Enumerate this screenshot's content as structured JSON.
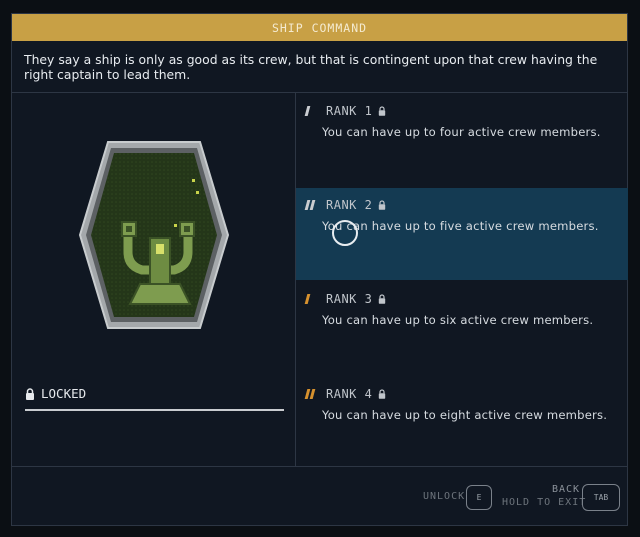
{
  "title": "SHIP COMMAND",
  "description": "They say a ship is only as good as its crew, but that is contingent upon that crew having the right captain to lead them.",
  "status": {
    "label": "LOCKED"
  },
  "ranks": [
    {
      "label": "RANK 1",
      "desc": "You can have up to four active crew members.",
      "pips": 1,
      "pip_color": "#c9ccd0",
      "selected": false
    },
    {
      "label": "RANK 2",
      "desc": "You can have up to five active crew members.",
      "pips": 2,
      "pip_color": "#c9ccd0",
      "selected": true
    },
    {
      "label": "RANK 3",
      "desc": "You can have up to six active crew members.",
      "pips": 1,
      "pip_color": "#d6912e",
      "selected": false
    },
    {
      "label": "RANK 4",
      "desc": "You can have up to eight active crew members.",
      "pips": 2,
      "pip_color": "#d6912e",
      "selected": false
    }
  ],
  "footer": {
    "unlock_label": "UNLOCK",
    "unlock_key": "E",
    "back_label": "BACK",
    "exit_label": "HOLD TO EXIT",
    "back_key": "TAB"
  },
  "colors": {
    "accent": "#c8a045",
    "selected_bg": "#143a52",
    "badge_green": "#5f7c3a"
  },
  "icons": {
    "lock": "lock-icon",
    "badge": "ship-command-badge"
  }
}
